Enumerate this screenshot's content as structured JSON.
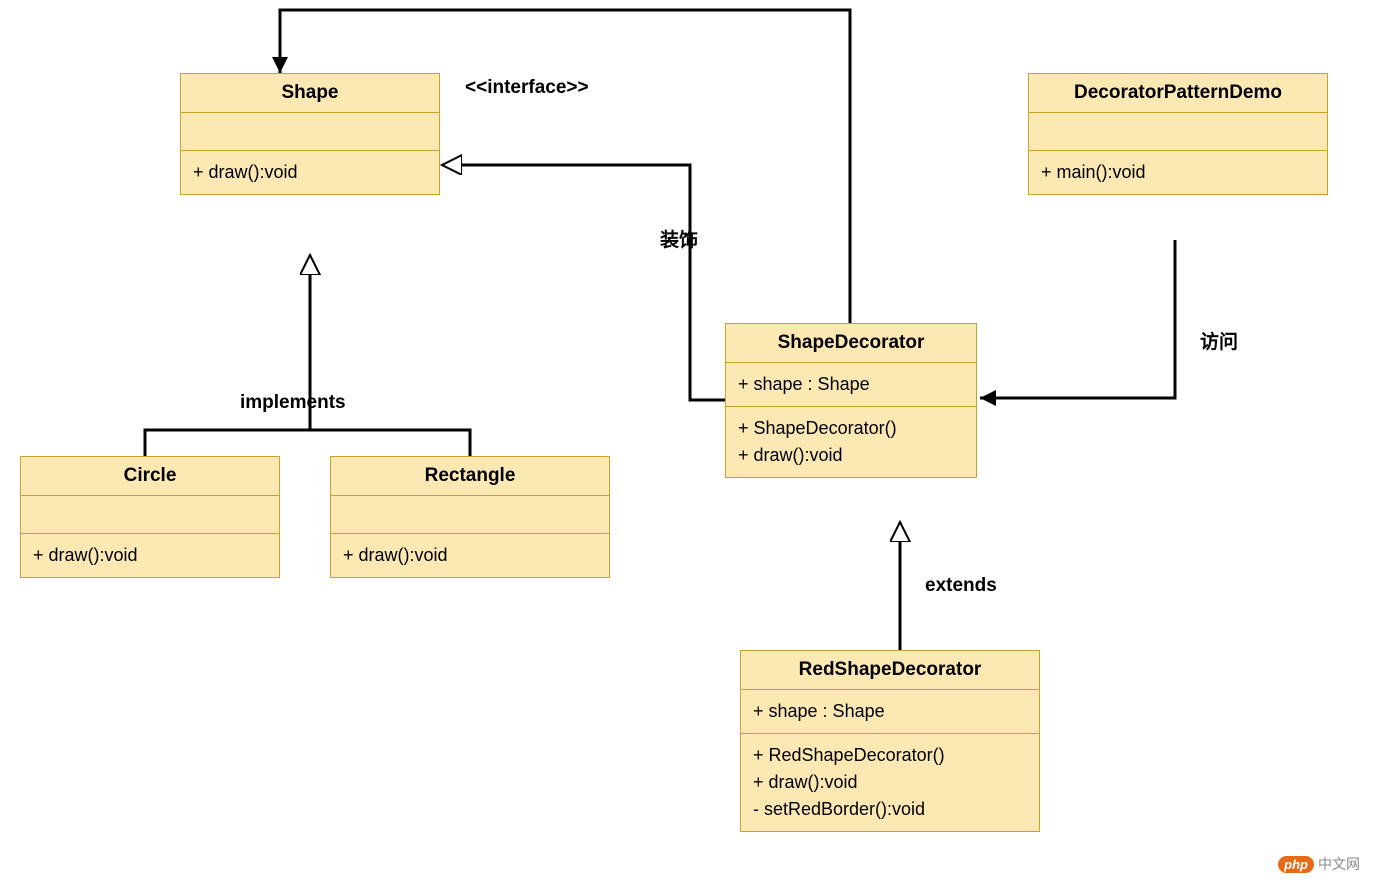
{
  "labels": {
    "interface": "<<interface>>",
    "decorate": "装饰",
    "access": "访问",
    "implements": "implements",
    "extends": "extends"
  },
  "classes": {
    "shape": {
      "name": "Shape",
      "ops": [
        "+ draw():void"
      ]
    },
    "circle": {
      "name": "Circle",
      "ops": [
        "+ draw():void"
      ]
    },
    "rectangle": {
      "name": "Rectangle",
      "ops": [
        "+ draw():void"
      ]
    },
    "shapeDecorator": {
      "name": "ShapeDecorator",
      "attrs": [
        "+ shape : Shape"
      ],
      "ops": [
        "+ ShapeDecorator()",
        "+ draw():void"
      ]
    },
    "redShapeDecorator": {
      "name": "RedShapeDecorator",
      "attrs": [
        "+ shape : Shape"
      ],
      "ops": [
        "+ RedShapeDecorator()",
        "+ draw():void",
        "- setRedBorder():void"
      ]
    },
    "decoratorPatternDemo": {
      "name": "DecoratorPatternDemo",
      "ops": [
        "+ main():void"
      ]
    }
  },
  "watermark": {
    "tag": "php",
    "text": "中文网"
  }
}
